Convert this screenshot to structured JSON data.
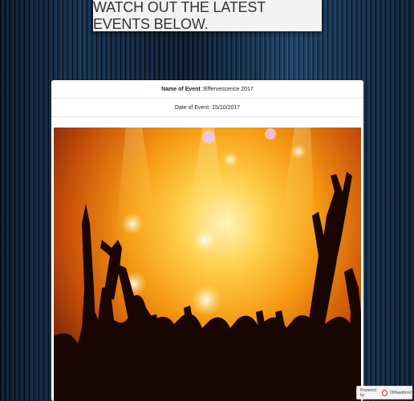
{
  "header": {
    "title": "WATCH OUT THE LATEST EVENTS BELOW."
  },
  "event": {
    "name_label": "Name of Event : ",
    "name_value": "Effervescence 2017",
    "date_label": "Date of Event : ",
    "date_value": "15/10/2017"
  },
  "footer": {
    "powered_by": "Powered by",
    "host": "000webhost"
  }
}
